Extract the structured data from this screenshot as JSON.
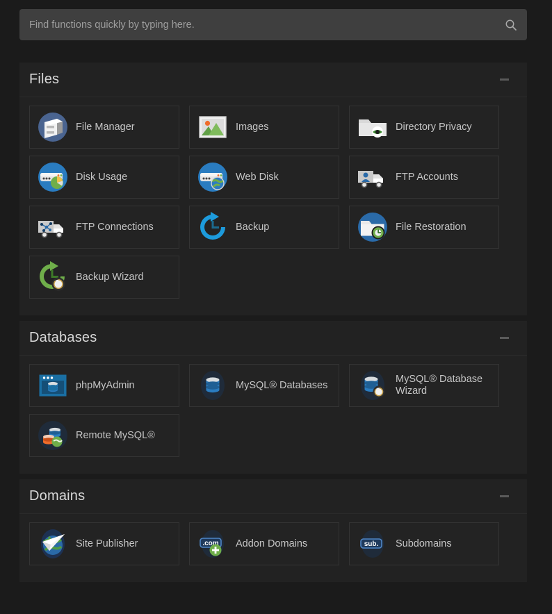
{
  "search": {
    "placeholder": "Find functions quickly by typing here.",
    "value": "",
    "icon": "search-icon"
  },
  "collapse_icon": "minus-icon",
  "colors": {
    "page_background": "#1b1b1b",
    "panel_background": "#222222",
    "tile_background": "#232323",
    "tile_border": "#343434",
    "search_background": "#3f3f3f",
    "text": "#c5c5c5",
    "heading": "#d8d8d8",
    "placeholder": "#9d9d9d",
    "accent_blue": "#1d7fc4",
    "accent_green": "#71b44a",
    "accent_orange": "#ef6c2b",
    "icon_disc": "#1f2b3a"
  },
  "sections": [
    {
      "title": "Files",
      "collapsed": false,
      "items": [
        {
          "label": "File Manager",
          "icon": "file-manager-icon"
        },
        {
          "label": "Images",
          "icon": "images-icon"
        },
        {
          "label": "Directory Privacy",
          "icon": "directory-privacy-icon"
        },
        {
          "label": "Disk Usage",
          "icon": "disk-usage-icon"
        },
        {
          "label": "Web Disk",
          "icon": "web-disk-icon"
        },
        {
          "label": "FTP Accounts",
          "icon": "ftp-accounts-icon"
        },
        {
          "label": "FTP Connections",
          "icon": "ftp-connections-icon"
        },
        {
          "label": "Backup",
          "icon": "backup-icon"
        },
        {
          "label": "File Restoration",
          "icon": "file-restoration-icon"
        },
        {
          "label": "Backup Wizard",
          "icon": "backup-wizard-icon"
        }
      ]
    },
    {
      "title": "Databases",
      "collapsed": false,
      "items": [
        {
          "label": "phpMyAdmin",
          "icon": "phpmyadmin-icon"
        },
        {
          "label": "MySQL® Databases",
          "icon": "mysql-databases-icon"
        },
        {
          "label": "MySQL® Database Wizard",
          "icon": "mysql-database-wizard-icon"
        },
        {
          "label": "Remote MySQL®",
          "icon": "remote-mysql-icon"
        }
      ]
    },
    {
      "title": "Domains",
      "collapsed": false,
      "items": [
        {
          "label": "Site Publisher",
          "icon": "site-publisher-icon"
        },
        {
          "label": "Addon Domains",
          "icon": "addon-domains-icon"
        },
        {
          "label": "Subdomains",
          "icon": "subdomains-icon"
        }
      ]
    }
  ]
}
